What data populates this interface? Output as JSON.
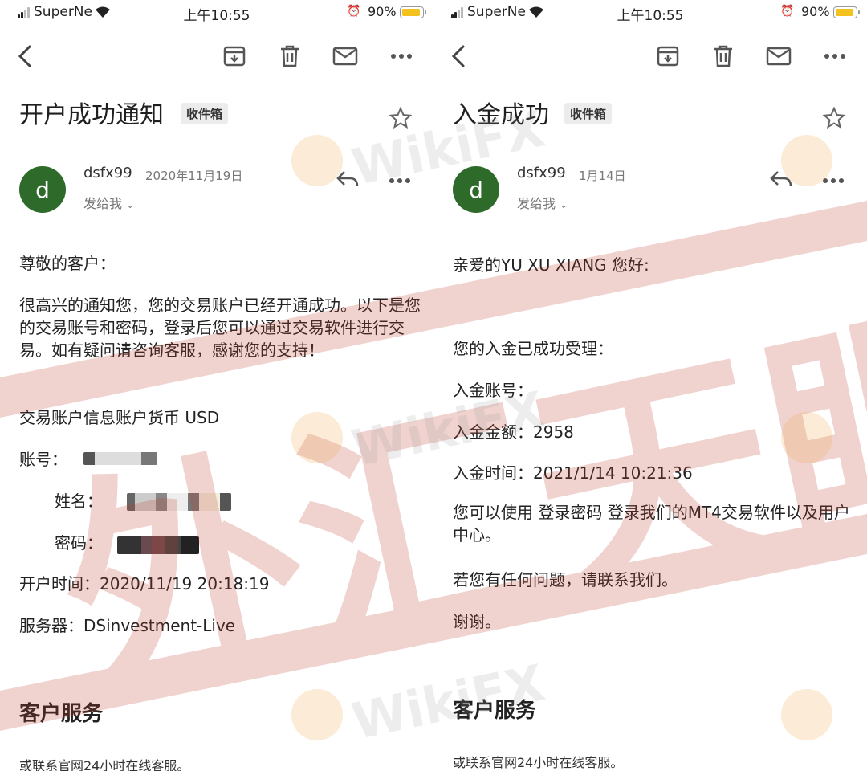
{
  "status_bar": {
    "carrier": "SuperNe",
    "time": "上午10:55",
    "battery": "90%",
    "battery_level": 0.9
  },
  "left_email": {
    "subject": "开户成功通知",
    "label": "收件箱",
    "sender_initial": "d",
    "sender": "dsfx99",
    "date": "2020年11月19日",
    "recipient": "发给我",
    "greeting": "尊敬的客户：",
    "paragraph": "很高兴的通知您，您的交易账户已经开通成功。以下是您的交易账号和密码，登录后您可以通过交易软件进行交易。如有疑问请咨询客服，感谢您的支持！",
    "currency_line": "交易账户信息账户货币 USD",
    "account_label": "账号：",
    "name_label": "姓名：",
    "password_label": "密码：",
    "open_time": "开户时间：2020/11/19 20:18:19",
    "server": "服务器：DSinvestment-Live",
    "section_title": "客户服务",
    "footer": "或联系官网24小时在线客服。"
  },
  "right_email": {
    "subject": "入金成功",
    "label": "收件箱",
    "sender_initial": "d",
    "sender": "dsfx99",
    "date": "1月14日",
    "recipient": "发给我",
    "greeting": "亲爱的YU XU XIANG 您好:",
    "accepted": "您的入金已成功受理：",
    "deposit_account": "入金账号：",
    "deposit_amount": "入金金额：2958",
    "deposit_time": "入金时间：2021/1/14 10:21:36",
    "paragraph": "您可以使用 登录密码 登录我们的MT4交易软件以及用户中心。",
    "contact": "若您有任何问题，请联系我们。",
    "thanks": "谢谢。",
    "section_title": "客户服务",
    "footer": "或联系官网24小时在线客服。"
  },
  "watermark": {
    "text": "WikiFX",
    "stamp": "外汇天眼"
  },
  "colors": {
    "avatar": "#2e6b2b",
    "watermark": "#c0392b"
  }
}
